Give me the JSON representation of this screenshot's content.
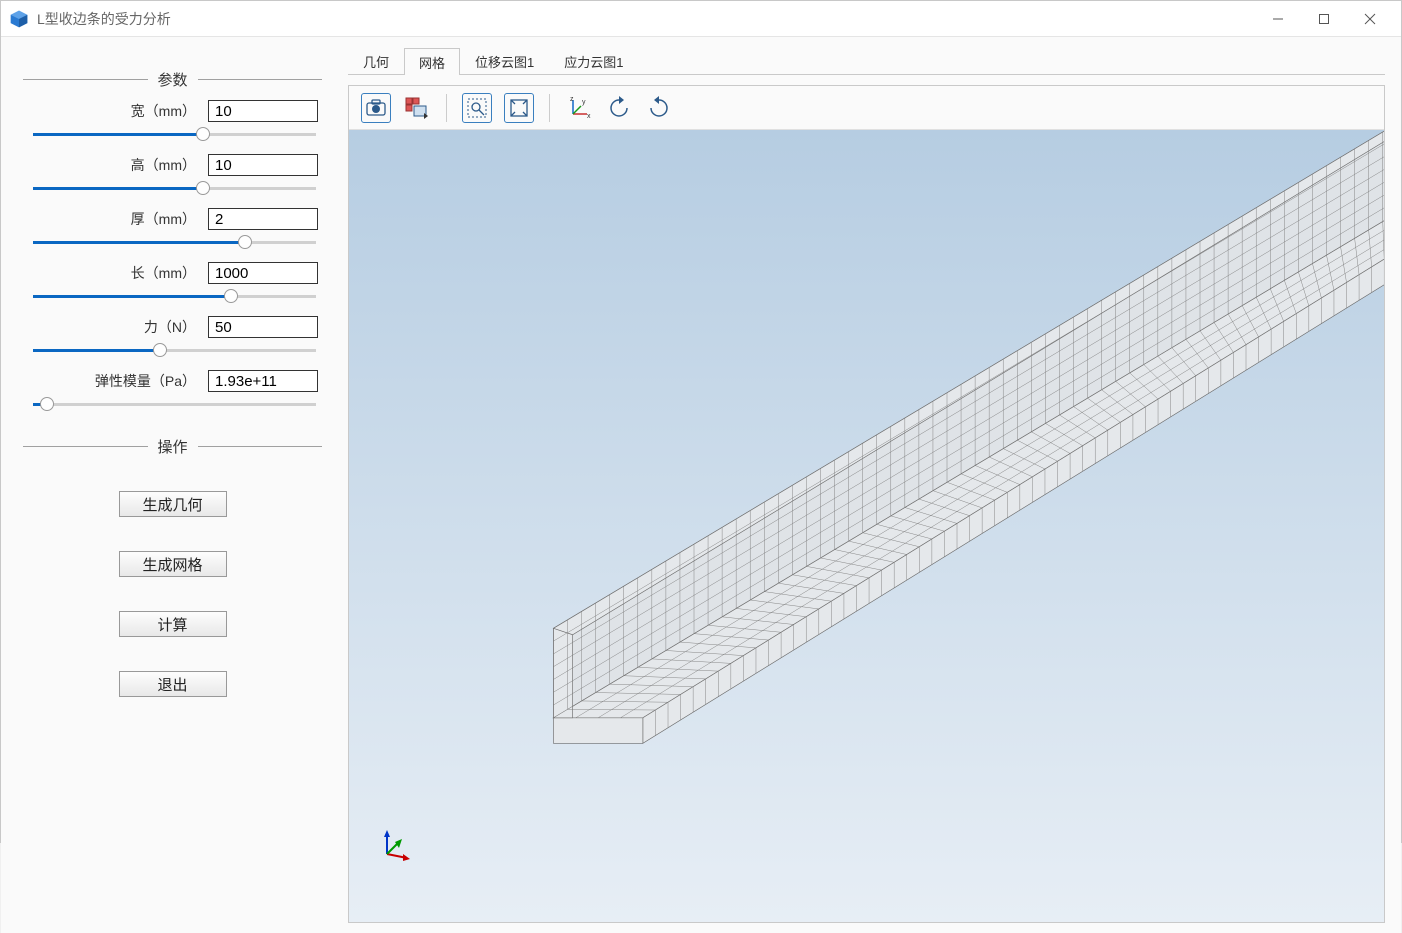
{
  "window": {
    "title": "L型收边条的受力分析"
  },
  "sections": {
    "params": "参数",
    "ops": "操作"
  },
  "params": [
    {
      "label": "宽（mm）",
      "value": "10",
      "pos": 60
    },
    {
      "label": "高（mm）",
      "value": "10",
      "pos": 60
    },
    {
      "label": "厚（mm）",
      "value": "2",
      "pos": 75
    },
    {
      "label": "长（mm）",
      "value": "1000",
      "pos": 70
    },
    {
      "label": "力（N）",
      "value": "50",
      "pos": 45
    },
    {
      "label": "弹性模量（Pa）",
      "value": "1.93e+11",
      "pos": 5
    }
  ],
  "ops": {
    "gen_geom": "生成几何",
    "gen_mesh": "生成网格",
    "compute": "计算",
    "exit": "退出"
  },
  "tabs": {
    "geometry": "几何",
    "mesh": "网格",
    "disp": "位移云图1",
    "stress": "应力云图1"
  }
}
